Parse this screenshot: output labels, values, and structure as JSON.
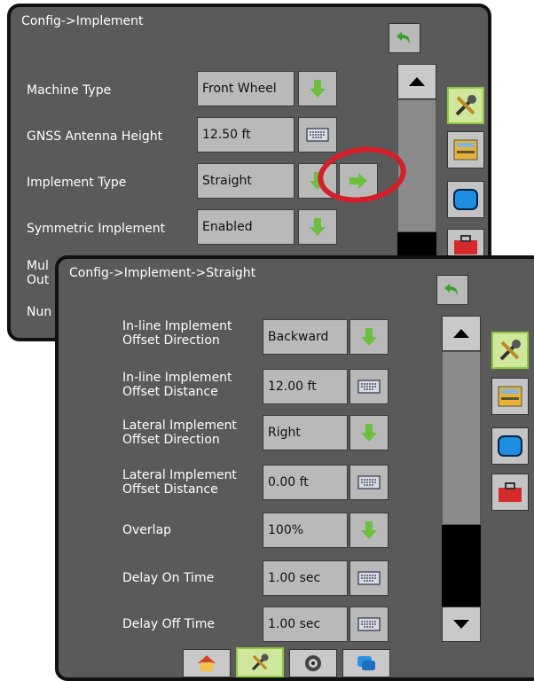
{
  "back_screen": {
    "title": "Config->Implement",
    "rows": [
      {
        "label": "Machine Type",
        "value": "Front Wheel",
        "control": "dropdown"
      },
      {
        "label": "GNSS Antenna Height",
        "value": "12.50 ft",
        "control": "keyboard"
      },
      {
        "label": "Implement Type",
        "value": "Straight",
        "control": "dropdown"
      },
      {
        "label": "Symmetric Implement",
        "value": "Enabled",
        "control": "dropdown"
      },
      {
        "label": "Mul",
        "label2": "Out",
        "value": "",
        "control": ""
      },
      {
        "label": "Nun",
        "value": "",
        "control": ""
      }
    ]
  },
  "front_screen": {
    "title": "Config->Implement->Straight",
    "rows": [
      {
        "label": "In-line Implement",
        "label2": "Offset Direction",
        "value": "Backward",
        "control": "dropdown"
      },
      {
        "label": "In-line Implement",
        "label2": "Offset Distance",
        "value": "12.00 ft",
        "control": "keyboard"
      },
      {
        "label": "Lateral Implement",
        "label2": "Offset Direction",
        "value": "Right",
        "control": "dropdown"
      },
      {
        "label": "Lateral Implement",
        "label2": "Offset Distance",
        "value": "0.00 ft",
        "control": "keyboard"
      },
      {
        "label": "Overlap",
        "value": "100%",
        "control": "dropdown"
      },
      {
        "label": "Delay On Time",
        "value": "1.00 sec",
        "control": "keyboard"
      },
      {
        "label": "Delay Off Time",
        "value": "1.00 sec",
        "control": "keyboard"
      }
    ]
  },
  "side_tabs": [
    "tools-icon",
    "console-icon",
    "display-icon",
    "toolbox-icon"
  ],
  "bottom_tabs": [
    "home-icon",
    "tools-icon",
    "gauge-icon",
    "window-icon"
  ],
  "colors": {
    "accent_green": "#8dc63f",
    "annotation_red": "#d41e2a",
    "panel_bg": "#5a5a5a"
  }
}
